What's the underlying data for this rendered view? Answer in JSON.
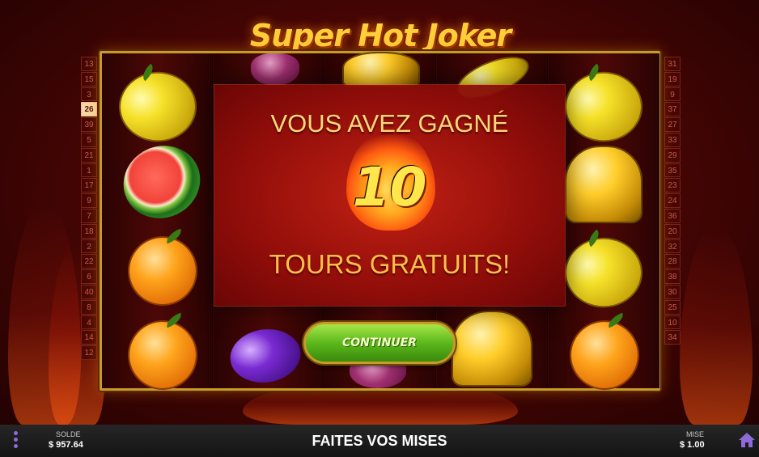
{
  "game": {
    "logo": "Super Hot Joker",
    "paylines_left": [
      "13",
      "15",
      "3",
      "26",
      "39",
      "5",
      "21",
      "1",
      "17",
      "9",
      "7",
      "18",
      "2",
      "22",
      "6",
      "40",
      "8",
      "4",
      "14",
      "12"
    ],
    "paylines_right": [
      "31",
      "19",
      "9",
      "37",
      "27",
      "33",
      "29",
      "35",
      "23",
      "24",
      "36",
      "20",
      "32",
      "28",
      "38",
      "30",
      "25",
      "10",
      "34"
    ],
    "active_payline": "26",
    "reels": [
      [
        "lemon",
        "watermelon",
        "orange",
        "orange"
      ],
      [
        "grapes",
        "grapes",
        "grapes",
        "plum"
      ],
      [
        "bell",
        "bell",
        "bell",
        "cherries"
      ],
      [
        "lemon",
        "bell",
        "lemon",
        "bell"
      ],
      [
        "lemon",
        "bell",
        "lemon",
        "orange"
      ]
    ]
  },
  "win_popup": {
    "line1": "VOUS AVEZ GAGNÉ",
    "count": "10",
    "line2": "TOURS GRATUITS!",
    "continue_label": "CONTINUER"
  },
  "bottom_bar": {
    "balance_label": "SOLDE",
    "balance_value": "$ 957.64",
    "status": "FAITES VOS MISES",
    "bet_label": "MISE",
    "bet_value": "$ 1.00"
  },
  "colors": {
    "accent_purple": "#8e6ad8",
    "frame_gold": "#c79a2a",
    "button_green": "#5cb81c"
  }
}
